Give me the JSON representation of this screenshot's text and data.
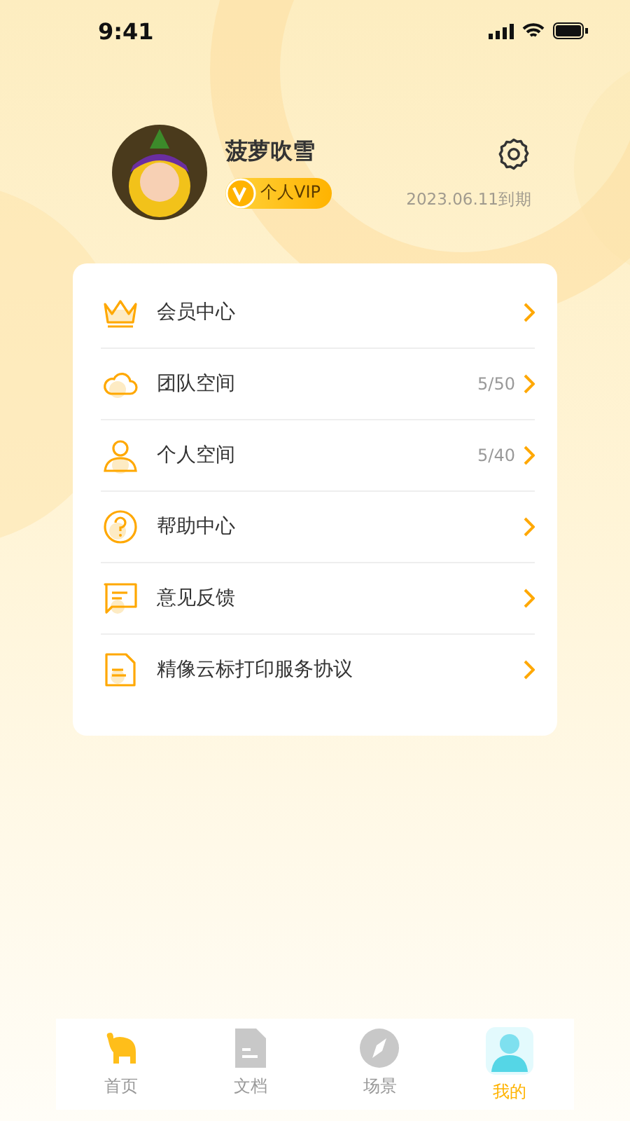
{
  "status_bar": {
    "time": "9:41"
  },
  "profile": {
    "name": "菠萝吹雪",
    "vip_badge": "个人VIP",
    "expiry": "2023.06.11到期"
  },
  "menu": [
    {
      "kind": "crown",
      "label": "会员中心"
    },
    {
      "kind": "cloud",
      "label": "团队空间",
      "count": "5/50"
    },
    {
      "kind": "person",
      "label": "个人空间",
      "count": "5/40"
    },
    {
      "kind": "help",
      "label": "帮助中心"
    },
    {
      "kind": "chat",
      "label": "意见反馈"
    },
    {
      "kind": "doc",
      "label": "精像云标打印服务协议"
    }
  ],
  "tab_bar": [
    {
      "kind": "home",
      "label": "首页",
      "selected": false
    },
    {
      "kind": "docs",
      "label": "文档",
      "selected": false
    },
    {
      "kind": "scene",
      "label": "场景",
      "selected": false
    },
    {
      "kind": "mine",
      "label": "我的",
      "selected": true
    }
  ]
}
